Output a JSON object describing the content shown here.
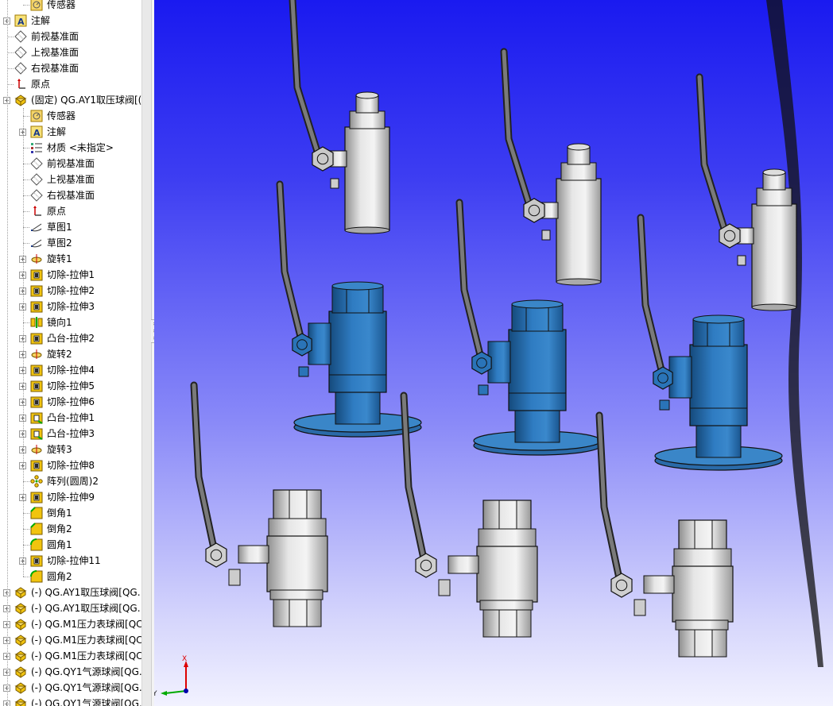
{
  "feature_tree": {
    "items": [
      {
        "label": "传感器",
        "icon": "sensor-icon",
        "level": 1,
        "expand": false
      },
      {
        "label": "注解",
        "icon": "annotation-icon",
        "level": 0,
        "expand": true
      },
      {
        "label": "前视基准面",
        "icon": "plane-icon",
        "level": 0,
        "expand": false
      },
      {
        "label": "上视基准面",
        "icon": "plane-icon",
        "level": 0,
        "expand": false
      },
      {
        "label": "右视基准面",
        "icon": "plane-icon",
        "level": 0,
        "expand": false
      },
      {
        "label": "原点",
        "icon": "origin-icon",
        "level": 0,
        "expand": false
      },
      {
        "label": "(固定) QG.AY1取压球阀[(",
        "icon": "part-icon",
        "level": 0,
        "expand": true
      },
      {
        "label": "传感器",
        "icon": "sensor-icon",
        "level": 1,
        "expand": false
      },
      {
        "label": "注解",
        "icon": "annotation-icon",
        "level": 1,
        "expand": true
      },
      {
        "label": "材质 <未指定>",
        "icon": "material-icon",
        "level": 1,
        "expand": false
      },
      {
        "label": "前视基准面",
        "icon": "plane-icon",
        "level": 1,
        "expand": false
      },
      {
        "label": "上视基准面",
        "icon": "plane-icon",
        "level": 1,
        "expand": false
      },
      {
        "label": "右视基准面",
        "icon": "plane-icon",
        "level": 1,
        "expand": false
      },
      {
        "label": "原点",
        "icon": "origin-icon",
        "level": 1,
        "expand": false
      },
      {
        "label": "草图1",
        "icon": "sketch-icon",
        "level": 1,
        "expand": false
      },
      {
        "label": "草图2",
        "icon": "sketch-icon",
        "level": 1,
        "expand": false
      },
      {
        "label": "旋转1",
        "icon": "revolve-icon",
        "level": 1,
        "expand": true
      },
      {
        "label": "切除-拉伸1",
        "icon": "cut-extrude-icon",
        "level": 1,
        "expand": true
      },
      {
        "label": "切除-拉伸2",
        "icon": "cut-extrude-icon",
        "level": 1,
        "expand": true
      },
      {
        "label": "切除-拉伸3",
        "icon": "cut-extrude-icon",
        "level": 1,
        "expand": true
      },
      {
        "label": "镜向1",
        "icon": "mirror-icon",
        "level": 1,
        "expand": false
      },
      {
        "label": "凸台-拉伸2",
        "icon": "cut-extrude-icon",
        "level": 1,
        "expand": true
      },
      {
        "label": "旋转2",
        "icon": "revolve-icon",
        "level": 1,
        "expand": true
      },
      {
        "label": "切除-拉伸4",
        "icon": "cut-extrude-icon",
        "level": 1,
        "expand": true
      },
      {
        "label": "切除-拉伸5",
        "icon": "cut-extrude-icon",
        "level": 1,
        "expand": true
      },
      {
        "label": "切除-拉伸6",
        "icon": "cut-extrude-icon",
        "level": 1,
        "expand": true
      },
      {
        "label": "凸台-拉伸1",
        "icon": "boss-extrude-icon",
        "level": 1,
        "expand": true
      },
      {
        "label": "凸台-拉伸3",
        "icon": "boss-extrude-icon",
        "level": 1,
        "expand": true
      },
      {
        "label": "旋转3",
        "icon": "revolve-icon",
        "level": 1,
        "expand": true
      },
      {
        "label": "切除-拉伸8",
        "icon": "cut-extrude-icon",
        "level": 1,
        "expand": true
      },
      {
        "label": "阵列(圆周)2",
        "icon": "circular-pattern-icon",
        "level": 1,
        "expand": false
      },
      {
        "label": "切除-拉伸9",
        "icon": "cut-extrude-icon",
        "level": 1,
        "expand": true
      },
      {
        "label": "倒角1",
        "icon": "chamfer-icon",
        "level": 1,
        "expand": false
      },
      {
        "label": "倒角2",
        "icon": "chamfer-icon",
        "level": 1,
        "expand": false
      },
      {
        "label": "圆角1",
        "icon": "fillet-icon",
        "level": 1,
        "expand": false
      },
      {
        "label": "切除-拉伸11",
        "icon": "cut-extrude-icon",
        "level": 1,
        "expand": true
      },
      {
        "label": "圆角2",
        "icon": "fillet-icon",
        "level": 1,
        "expand": false
      },
      {
        "label": "(-) QG.AY1取压球阀[QG.",
        "icon": "part-icon",
        "level": 0,
        "expand": true
      },
      {
        "label": "(-) QG.AY1取压球阀[QG.",
        "icon": "part-icon",
        "level": 0,
        "expand": true
      },
      {
        "label": "(-) QG.M1压力表球阀[QC",
        "icon": "part-icon",
        "level": 0,
        "expand": true
      },
      {
        "label": "(-) QG.M1压力表球阀[QC",
        "icon": "part-icon",
        "level": 0,
        "expand": true
      },
      {
        "label": "(-) QG.M1压力表球阀[QC",
        "icon": "part-icon",
        "level": 0,
        "expand": true
      },
      {
        "label": "(-) QG.QY1气源球阀[QG.",
        "icon": "part-icon",
        "level": 0,
        "expand": true
      },
      {
        "label": "(-) QG.QY1气源球阀[QG.",
        "icon": "part-icon",
        "level": 0,
        "expand": true
      },
      {
        "label": "(-) QG.QY1气源球阀[QG.",
        "icon": "part-icon",
        "level": 0,
        "expand": true
      }
    ]
  },
  "triad": {
    "x_label": "X",
    "y_label": "Y"
  },
  "colors": {
    "blue_valve": "#2a74b8",
    "gray_valve": "#cfcfcf",
    "viewport_top": "#1a1af0",
    "viewport_bottom": "#f2f2ff"
  }
}
